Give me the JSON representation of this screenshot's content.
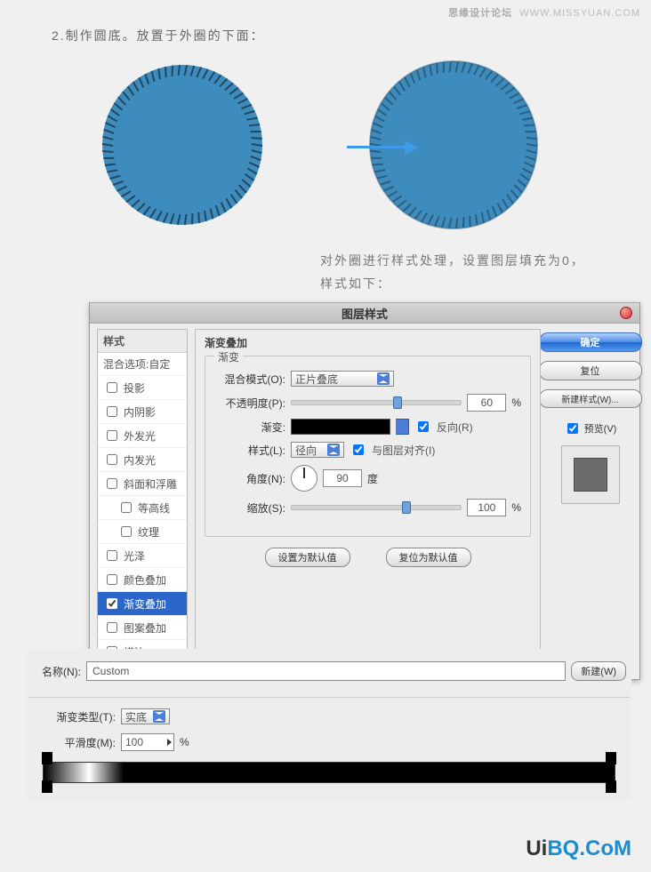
{
  "watermark_top": {
    "cn": "思缘设计论坛",
    "en": "WWW.MISSYUAN.COM"
  },
  "step_text": "2.制作圆底。放置于外圈的下面：",
  "caption_line1": "对外圈进行样式处理，设置图层填充为0，",
  "caption_line2": "样式如下：",
  "illustration": {
    "circle_fill": "#3e8bbd",
    "stitch_color": "#2c5878"
  },
  "dialog": {
    "title": "图层样式",
    "style_header": "样式",
    "blend_default": "混合选项:自定",
    "items": [
      {
        "label": "投影",
        "checked": false
      },
      {
        "label": "内阴影",
        "checked": false
      },
      {
        "label": "外发光",
        "checked": false
      },
      {
        "label": "内发光",
        "checked": false
      },
      {
        "label": "斜面和浮雕",
        "checked": false
      },
      {
        "label": "等高线",
        "checked": false,
        "sub": true
      },
      {
        "label": "纹理",
        "checked": false,
        "sub": true
      },
      {
        "label": "光泽",
        "checked": false
      },
      {
        "label": "颜色叠加",
        "checked": false
      },
      {
        "label": "渐变叠加",
        "checked": true,
        "selected": true
      },
      {
        "label": "图案叠加",
        "checked": false
      },
      {
        "label": "描边",
        "checked": false
      }
    ],
    "settings_title": "渐变叠加",
    "group_label": "渐变",
    "labels": {
      "blend_mode": "混合模式(O):",
      "opacity": "不透明度(P):",
      "gradient": "渐变:",
      "reverse": "反向(R)",
      "style": "样式(L):",
      "align": "与图层对齐(I)",
      "angle": "角度(N):",
      "degree": "度",
      "scale": "缩放(S):"
    },
    "values": {
      "blend_mode": "正片叠底",
      "opacity": "60",
      "style": "径向",
      "angle": "90",
      "scale": "100",
      "reverse_checked": true,
      "align_checked": true
    },
    "buttons": {
      "make_default": "设置为默认值",
      "reset_default": "复位为默认值"
    },
    "side": {
      "ok": "确定",
      "reset": "复位",
      "new_style": "新建样式(W)...",
      "preview": "预览(V)"
    }
  },
  "gradient_editor": {
    "name_label": "名称(N):",
    "name_value": "Custom",
    "new_btn": "新建(W)",
    "type_label": "渐变类型(T):",
    "type_value": "实底",
    "smooth_label": "平滑度(M):",
    "smooth_value": "100",
    "percent": "%"
  },
  "watermark_bot": {
    "p1": "Ui",
    "p2": "BQ.CoM"
  }
}
